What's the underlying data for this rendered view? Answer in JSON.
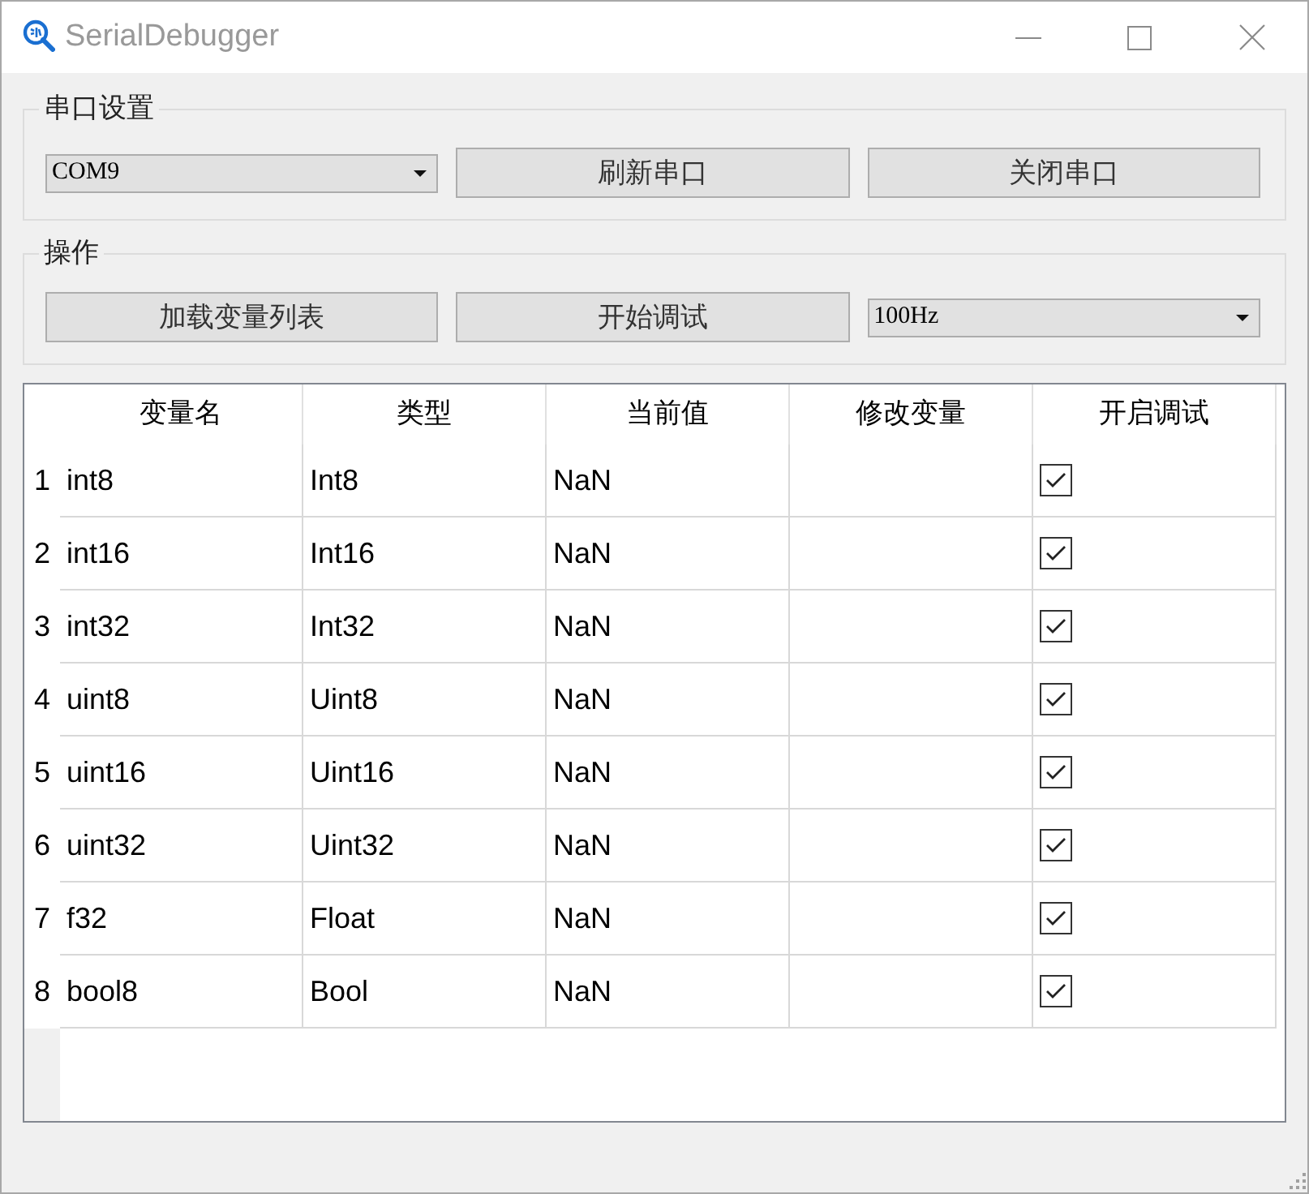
{
  "window": {
    "title": "SerialDebugger"
  },
  "serial_settings": {
    "title": "串口设置",
    "port": {
      "value": "COM9"
    },
    "buttons": [
      {
        "label": "刷新串口"
      },
      {
        "label": "关闭串口"
      }
    ]
  },
  "operations": {
    "title": "操作",
    "buttons": [
      {
        "label": "加载变量列表"
      },
      {
        "label": "开始调试"
      }
    ],
    "rate": {
      "value": "100Hz"
    }
  },
  "table": {
    "columns": [
      "变量名",
      "类型",
      "当前值",
      "修改变量",
      "开启调试"
    ],
    "rows": [
      {
        "index": "1",
        "name": "int8",
        "type": "Int8",
        "value": "NaN",
        "debug_enabled": true
      },
      {
        "index": "2",
        "name": "int16",
        "type": "Int16",
        "value": "NaN",
        "debug_enabled": true
      },
      {
        "index": "3",
        "name": "int32",
        "type": "Int32",
        "value": "NaN",
        "debug_enabled": true
      },
      {
        "index": "4",
        "name": "uint8",
        "type": "Uint8",
        "value": "NaN",
        "debug_enabled": true
      },
      {
        "index": "5",
        "name": "uint16",
        "type": "Uint16",
        "value": "NaN",
        "debug_enabled": true
      },
      {
        "index": "6",
        "name": "uint32",
        "type": "Uint32",
        "value": "NaN",
        "debug_enabled": true
      },
      {
        "index": "7",
        "name": "f32",
        "type": "Float",
        "value": "NaN",
        "debug_enabled": true
      },
      {
        "index": "8",
        "name": "bool8",
        "type": "Bool",
        "value": "NaN",
        "debug_enabled": true
      }
    ]
  }
}
